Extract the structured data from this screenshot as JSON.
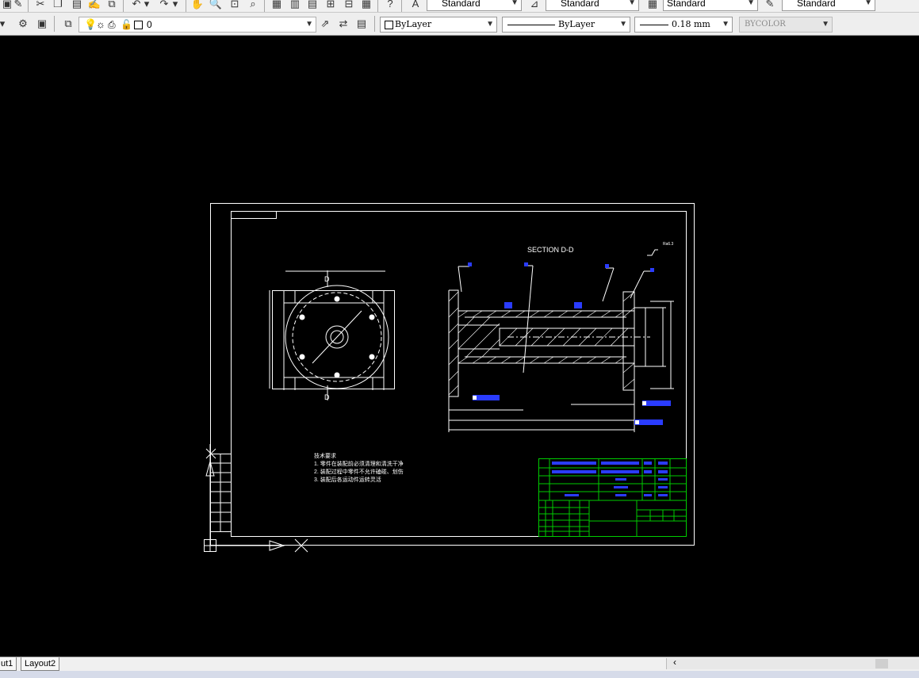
{
  "toolbar_top": {
    "text_style": "Standard",
    "dim_style": "Standard",
    "table_style": "Standard",
    "multileader_style": "Standard"
  },
  "toolbar_properties": {
    "layer_current": "0",
    "color": "ByLayer",
    "linetype": "ByLayer",
    "lineweight": "0.18 mm",
    "plotstyle": "BYCOLOR"
  },
  "drawing": {
    "section_label": "SECTION  D-D",
    "cut_label_top": "D",
    "cut_label_bottom": "D",
    "roughness": "Ra6.3",
    "tech_req_title": "技术要求",
    "tech_req_1": "1. 零件在装配前必须清理和清洗干净",
    "tech_req_2": "2. 装配过程中零件不允许磕碰、划伤",
    "tech_req_3": "3. 装配后各运动件运转灵活"
  },
  "tabs": {
    "layout1": "ut1",
    "layout2": "Layout2"
  },
  "colors": {
    "background": "#000000",
    "lines": "#ffffff",
    "title_block": "#00cc00",
    "dim_labels": "#2a3cff"
  }
}
